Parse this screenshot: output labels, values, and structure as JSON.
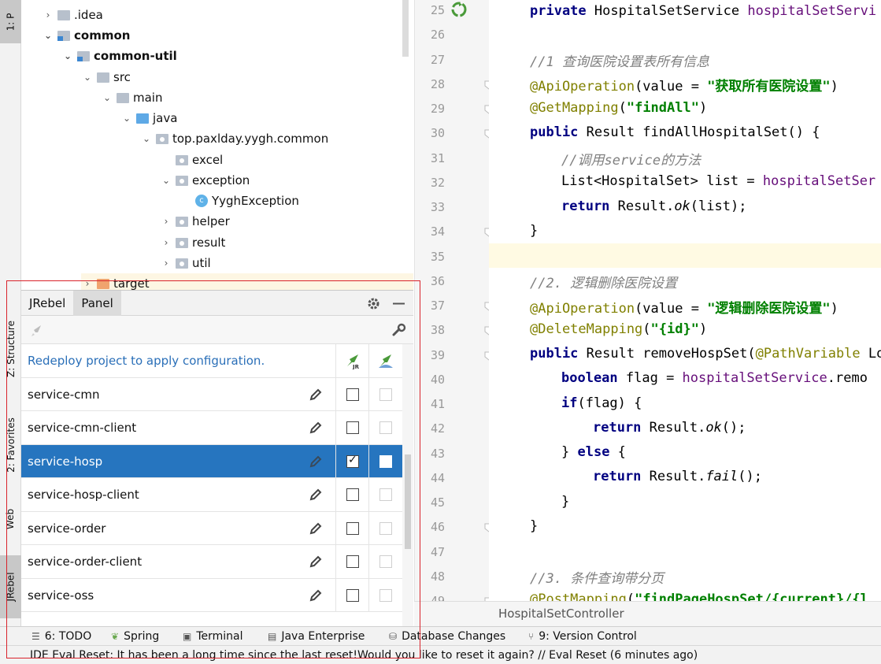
{
  "left_strip": {
    "project_tab": "1: P",
    "structure_tab": "Z: Structure",
    "favorites_tab": "2: Favorites",
    "web_tab": "Web",
    "jrebel_tab": "JRebel"
  },
  "project_tree": {
    "items": [
      {
        "label": ".idea"
      },
      {
        "label": "common"
      },
      {
        "label": "common-util"
      },
      {
        "label": "src"
      },
      {
        "label": "main"
      },
      {
        "label": "java"
      },
      {
        "label": "top.paxlday.yygh.common"
      },
      {
        "label": "excel"
      },
      {
        "label": "exception"
      },
      {
        "label": "YyghException"
      },
      {
        "label": "helper"
      },
      {
        "label": "result"
      },
      {
        "label": "util"
      },
      {
        "label": "target"
      }
    ]
  },
  "jrebel": {
    "tab_jrebel": "JRebel",
    "tab_panel": "Panel",
    "redeploy_text": "Redeploy project to apply configuration.",
    "modules": [
      {
        "name": "service-cmn",
        "checked": false,
        "selected": false
      },
      {
        "name": "service-cmn-client",
        "checked": false,
        "selected": false
      },
      {
        "name": "service-hosp",
        "checked": true,
        "selected": true
      },
      {
        "name": "service-hosp-client",
        "checked": false,
        "selected": false
      },
      {
        "name": "service-order",
        "checked": false,
        "selected": false
      },
      {
        "name": "service-order-client",
        "checked": false,
        "selected": false
      },
      {
        "name": "service-oss",
        "checked": false,
        "selected": false
      }
    ]
  },
  "editor": {
    "line_numbers": [
      "25",
      "26",
      "27",
      "28",
      "29",
      "30",
      "31",
      "32",
      "33",
      "34",
      "35",
      "36",
      "37",
      "38",
      "39",
      "40",
      "41",
      "42",
      "43",
      "44",
      "45",
      "46",
      "47",
      "48",
      "49"
    ],
    "lines": {
      "l25_kw": "private ",
      "l25_type": "HospitalSetService ",
      "l25_field": "hospitalSetServi",
      "l27": "//1 查询医院设置表所有信息",
      "l28_ann": "@ApiOperation",
      "l28_a": "(value = ",
      "l28_str": "\"获取所有医院设置\"",
      "l28_b": ")",
      "l29_ann": "@GetMapping",
      "l29_a": "(",
      "l29_str": "\"findAll\"",
      "l29_b": ")",
      "l30_kw": "public ",
      "l30_rest": "Result findAllHospitalSet() {",
      "l31": "//调用service的方法",
      "l32_a": "List<HospitalSet> list = ",
      "l32_field": "hospitalSetSer",
      "l33_kw": "return ",
      "l33_a": "Result.",
      "l33_it": "ok",
      "l33_b": "(list);",
      "l34": "}",
      "l36": "//2. 逻辑删除医院设置",
      "l37_ann": "@ApiOperation",
      "l37_a": "(value = ",
      "l37_str": "\"逻辑删除医院设置\"",
      "l37_b": ")",
      "l38_ann": "@DeleteMapping",
      "l38_a": "(",
      "l38_str": "\"{id}\"",
      "l38_b": ")",
      "l39_kw": "public ",
      "l39_a": "Result removeHospSet(",
      "l39_ann": "@PathVariable ",
      "l39_b": "Lo",
      "l40_kw": "boolean ",
      "l40_a": "flag = ",
      "l40_field": "hospitalSetService",
      "l40_b": ".remo",
      "l41_kw": "if",
      "l41_a": "(flag) {",
      "l42_kw": "return ",
      "l42_a": "Result.",
      "l42_it": "ok",
      "l42_b": "();",
      "l43_a": "} ",
      "l43_kw": "else ",
      "l43_b": "{",
      "l44_kw": "return ",
      "l44_a": "Result.",
      "l44_it": "fail",
      "l44_b": "();",
      "l45": "}",
      "l46": "}",
      "l48": "//3. 条件查询带分页",
      "l49_ann": "@PostMapping",
      "l49_a": "(",
      "l49_str": "\"findPageHospSet/{current}/{l"
    },
    "breadcrumb": "HospitalSetController"
  },
  "toolwindows": {
    "todo": "6: TODO",
    "spring": "Spring",
    "terminal": "Terminal",
    "java_enterprise": "Java Enterprise",
    "database_changes": "Database Changes",
    "version_control": "9: Version Control"
  },
  "status": {
    "message": "IDE Eval Reset: It has been a long time since the last reset!Would you like to reset it again? // Eval Reset (6 minutes ago)"
  },
  "colors": {
    "selection": "#2675bf",
    "annotation_box": "#d9232b",
    "string": "#008000",
    "keyword": "#000080",
    "comment": "#808080"
  }
}
